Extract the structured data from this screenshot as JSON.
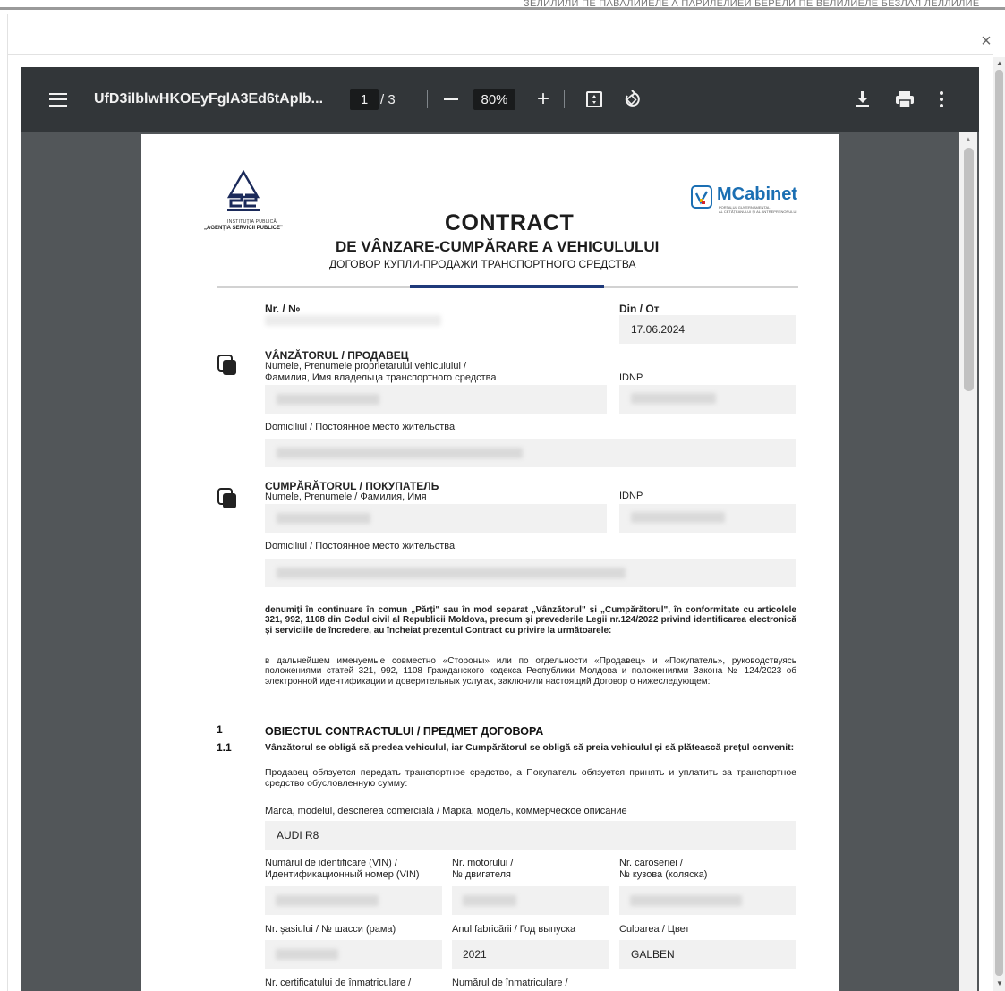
{
  "background_text": "ЗЕЛИЛИЛИ ПЕ ПАВАЛИИЕЛЕ А ПАРИЛЕЛИЕЙ БЕРЕЛИ ПЕ ВЕЛИЛИЕЛЕ БЕЗЛАЛ ЛЕЛЛИЛИЕ",
  "modal": {
    "close": "×"
  },
  "toolbar": {
    "menu_icon": "menu-icon",
    "title": "UfD3ilblwHKOEyFglA3Ed6tAplb...",
    "page_current": "1",
    "page_total_text": "/  3",
    "zoom": "80%",
    "zoom_out_icon": "minus-icon",
    "zoom_in": "+",
    "fit_icon": "fit-page-icon",
    "rotate_icon": "rotate-icon",
    "download_icon": "download-icon",
    "print_icon": "print-icon",
    "more_icon": "more-vertical-icon"
  },
  "document": {
    "logo_asp_line1": "INSTITUȚIA PUBLICĂ",
    "logo_asp_line2": "„AGENȚIA SERVICII PUBLICE\"",
    "logo_mcabinet": "MCabinet",
    "logo_mcabinet_sub1": "PORTALUL GUVERNAMENTAL",
    "logo_mcabinet_sub2": "AL CETĂȚEANULUI ȘI AL ANTREPRENORULUI",
    "title": "CONTRACT",
    "subtitle": "DE VÂNZARE-CUMPĂRARE A VEHICULULUI",
    "subtitle_ru": "ДОГОВОР КУПЛИ-ПРОДАЖИ ТРАНСПОРТНОГО СРЕДСТВА",
    "nr_label": "Nr. / №",
    "din_label": "Din / От",
    "date": "17.06.2024",
    "seller_title": "VÂNZĂTORUL / ПРОДАВЕЦ",
    "seller_name_label_1": "Numele, Prenumele proprietarului vehiculului /",
    "seller_name_label_2": "Фамилия, Имя владельца транспортного средства",
    "idnp_label": "IDNP",
    "domicile_label": "Domiciliul / Постоянное место жительства",
    "buyer_title": "CUMPĂRĂTORUL / ПОКУПАТЕЛЬ",
    "buyer_name_label": "Numele, Prenumele / Фамилия, Имя",
    "para_ro": "denumiți în continuare în comun „Părți\" sau în mod separat „Vânzătorul\" și „Cumpărătorul\", în conformitate cu articolele 321, 992, 1108 din Codul civil al Republicii Moldova, precum și prevederile Legii nr.124/2022 privind identificarea electronică și serviciile de încredere, au încheiat prezentul Contract cu privire la următoarele:",
    "para_ru": "в дальнейшем именуемые совместно «Стороны» или по отдельности «Продавец» и «Покупатель», руководствуясь положениями статей 321, 992, 1108 Гражданского кодекса Республики Молдова и положениями Закона № 124/2023 об электронной идентификации и доверительных услугах, заключили настоящий Договор о нижеследующем:",
    "section1_num": "1",
    "section1_title": "OBIECTUL CONTRACTULUI / ПРЕДМЕТ ДОГОВОРА",
    "clause11_num": "1.1",
    "clause11_ro": "Vânzătorul se obligă să predea vehiculul, iar Cumpărătorul se obligă să preia vehiculul și să plătească prețul convenit:",
    "clause11_ru": "Продавец обязуется передать транспортное средство, а Покупатель обязуется принять и уплатить за транспортное средство обусловленную сумму:",
    "brand_label": "Marca, modelul, descrierea comercială / Марка, модель, коммерческое описание",
    "brand_value": "AUDI R8",
    "vin_label_1": "Numărul de identificare (VIN) /",
    "vin_label_2": "Идентификационный номер (VIN)",
    "engine_label_1": "Nr. motorului /",
    "engine_label_2": "№ двигателя",
    "body_label_1": "Nr. caroseriei /",
    "body_label_2": "№ кузова (коляска)",
    "chassis_label": "Nr. șasiului / № шасси (рама)",
    "year_label": "Anul fabricării / Год выпуска",
    "year_value": "2021",
    "color_label": "Culoarea / Цвет",
    "color_value": "GALBEN",
    "cert_label": "Nr. certificatului de înmatriculare /",
    "regnum_label": "Numărul de înmatriculare /"
  }
}
